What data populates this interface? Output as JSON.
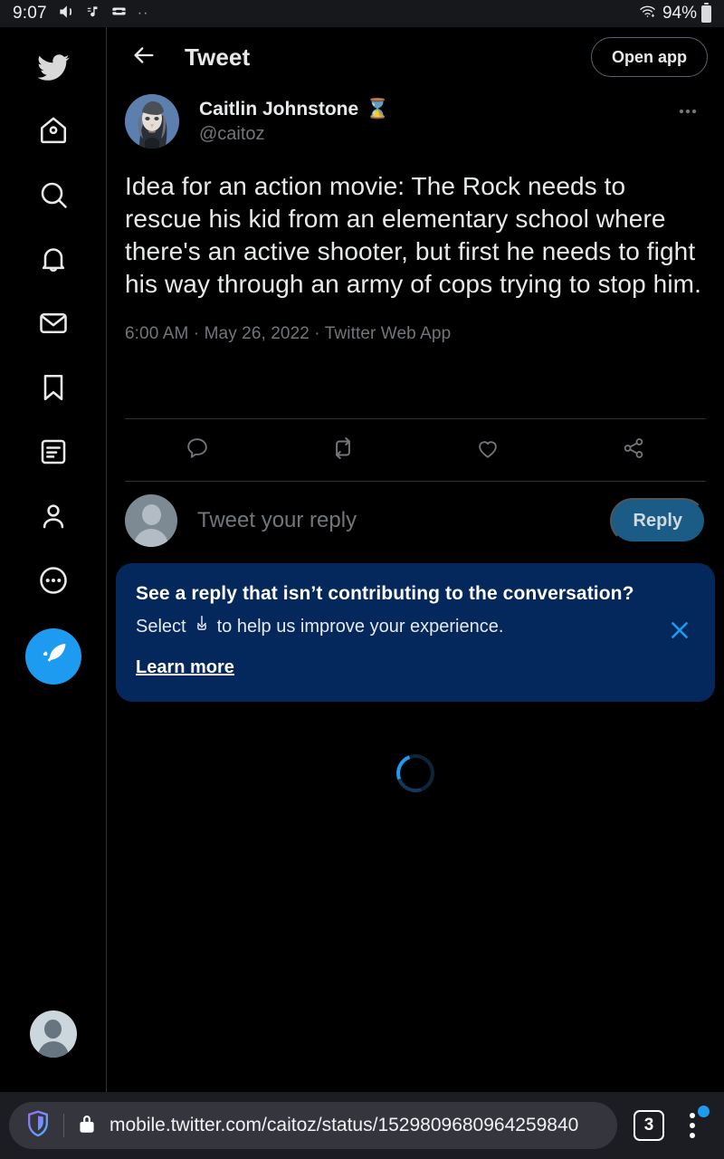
{
  "status_bar": {
    "time": "9:07",
    "icons": [
      "volume-icon",
      "music-note-icon",
      "android-auto-icon",
      "more-dots-icon"
    ],
    "wifi_icon": "wifi-icon",
    "battery_percent": "94%"
  },
  "sidebar": {
    "logo": "twitter-bird-logo",
    "items": [
      {
        "name": "home",
        "icon": "home-icon"
      },
      {
        "name": "explore",
        "icon": "search-icon"
      },
      {
        "name": "notifications",
        "icon": "bell-icon"
      },
      {
        "name": "messages",
        "icon": "envelope-icon"
      },
      {
        "name": "bookmarks",
        "icon": "bookmark-icon"
      },
      {
        "name": "lists",
        "icon": "list-icon"
      },
      {
        "name": "profile",
        "icon": "person-icon"
      },
      {
        "name": "more",
        "icon": "more-circle-icon"
      }
    ],
    "compose_icon": "compose-feather-icon",
    "account_avatar": "default-avatar"
  },
  "header": {
    "back_icon": "arrow-left-icon",
    "title": "Tweet",
    "open_app_label": "Open app"
  },
  "tweet": {
    "display_name": "Caitlin Johnstone",
    "name_emoji": "⌛",
    "handle": "@caitoz",
    "more_icon": "more-horizontal-icon",
    "text": "Idea for an action movie: The Rock needs to rescue his kid from an elementary school where there's an active shooter, but first he needs to fight his way through an army of cops trying to stop him.",
    "time": "6:00 AM",
    "date": "May 26, 2022",
    "source": "Twitter Web App",
    "meta_line": "6:00 AM · May 26, 2022 · Twitter Web App",
    "actions": [
      {
        "name": "reply",
        "icon": "comment-icon",
        "count": ""
      },
      {
        "name": "retweet",
        "icon": "retweet-icon",
        "count": ""
      },
      {
        "name": "like",
        "icon": "heart-icon",
        "count": ""
      },
      {
        "name": "share",
        "icon": "share-icon",
        "count": ""
      }
    ]
  },
  "composer": {
    "avatar": "default-avatar",
    "placeholder": "Tweet your reply",
    "reply_label": "Reply"
  },
  "notice": {
    "title": "See a reply that isn’t contributing to the conversation?",
    "subtitle_before": "Select",
    "subtitle_icon": "downvote-arrow-icon",
    "subtitle_after": "to help us improve your experience.",
    "link_label": "Learn more",
    "close_icon": "close-icon",
    "background_color": "#04285c"
  },
  "loading": {
    "spinner_icon": "loading-spinner",
    "accent_color": "#1d9bf0"
  },
  "browser_bar": {
    "shield_icon": "brave-shield-icon",
    "lock_icon": "lock-icon",
    "url": "mobile.twitter.com/caitoz/status/1529809680964259840",
    "tab_count": "3",
    "menu_icon": "kebab-menu-icon"
  }
}
